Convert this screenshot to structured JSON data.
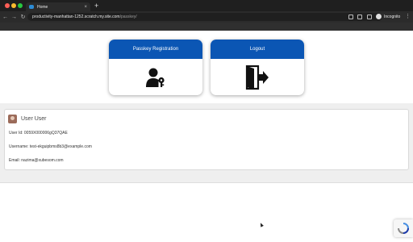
{
  "browser": {
    "tab_title": "Home",
    "tab_close": "×",
    "new_tab": "+",
    "url_host": "productivity-manhattan-1252.scratch.my.site.com",
    "url_path": "/passkey/",
    "profile_label": "Incognito",
    "back": "←",
    "forward": "→",
    "reload": "↻",
    "menu": "⋮"
  },
  "cards": [
    {
      "title": "Passkey Registration",
      "icon": "user-key-icon"
    },
    {
      "title": "Logout",
      "icon": "logout-door-icon"
    }
  ],
  "user": {
    "name": "User User",
    "id_line": "User Id: 0059X000006gQ37QAE",
    "username_line": "Username: test-ekguipbms8b3@example.com",
    "email_line": "Email: nazima@xubesom.com"
  },
  "colors": {
    "card_header": "#0b56b4",
    "page_band": "#efefef"
  }
}
